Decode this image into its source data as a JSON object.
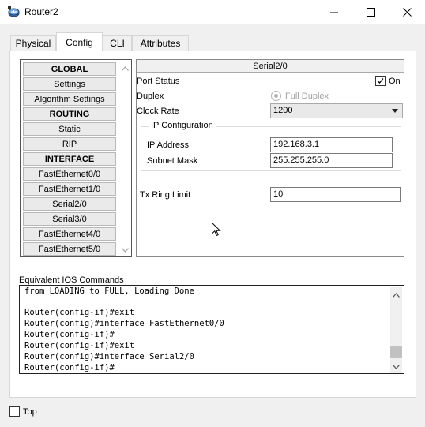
{
  "window": {
    "title": "Router2",
    "icon": "router-icon",
    "minimize_glyph": "—",
    "maximize_glyph": "☐",
    "close_glyph": "✕"
  },
  "tabs": [
    {
      "label": "Physical",
      "active": false
    },
    {
      "label": "Config",
      "active": true
    },
    {
      "label": "CLI",
      "active": false
    },
    {
      "label": "Attributes",
      "active": false
    }
  ],
  "nav": {
    "items": [
      {
        "label": "GLOBAL",
        "header": true
      },
      {
        "label": "Settings",
        "header": false
      },
      {
        "label": "Algorithm Settings",
        "header": false
      },
      {
        "label": "ROUTING",
        "header": true
      },
      {
        "label": "Static",
        "header": false
      },
      {
        "label": "RIP",
        "header": false
      },
      {
        "label": "INTERFACE",
        "header": true
      },
      {
        "label": "FastEthernet0/0",
        "header": false
      },
      {
        "label": "FastEthernet1/0",
        "header": false
      },
      {
        "label": "Serial2/0",
        "header": false
      },
      {
        "label": "Serial3/0",
        "header": false
      },
      {
        "label": "FastEthernet4/0",
        "header": false
      },
      {
        "label": "FastEthernet5/0",
        "header": false
      }
    ]
  },
  "detail": {
    "title": "Serial2/0",
    "port_status_label": "Port Status",
    "port_status_on_label": "On",
    "port_status_on": true,
    "duplex_label": "Duplex",
    "full_duplex_label": "Full Duplex",
    "clock_rate_label": "Clock Rate",
    "clock_rate_value": "1200",
    "ip_config_title": "IP Configuration",
    "ip_address_label": "IP Address",
    "ip_address_value": "192.168.3.1",
    "subnet_mask_label": "Subnet Mask",
    "subnet_mask_value": "255.255.255.0",
    "tx_ring_label": "Tx Ring Limit",
    "tx_ring_value": "10"
  },
  "ios": {
    "label": "Equivalent IOS Commands",
    "lines": [
      "from LOADING to FULL, Loading Done",
      "",
      "Router(config-if)#exit",
      "Router(config)#interface FastEthernet0/0",
      "Router(config-if)#",
      "Router(config-if)#exit",
      "Router(config)#interface Serial2/0",
      "Router(config-if)#"
    ]
  },
  "footer": {
    "top_label": "Top",
    "top_checked": false
  }
}
